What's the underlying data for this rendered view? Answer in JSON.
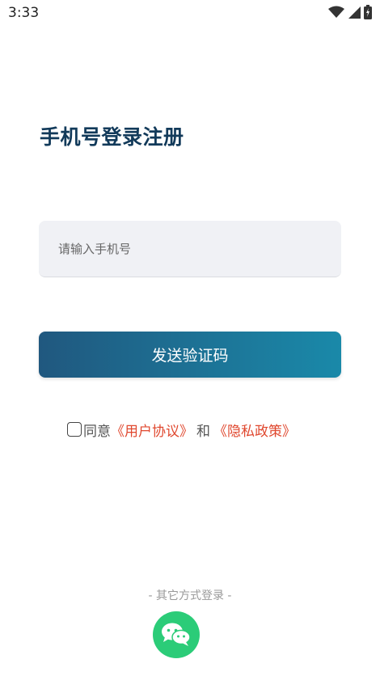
{
  "status_bar": {
    "time": "3:33",
    "icons": [
      "wifi-icon",
      "signal-icon",
      "battery-icon"
    ]
  },
  "page": {
    "title": "手机号登录注册"
  },
  "phone_input": {
    "placeholder": "请输入手机号",
    "value": ""
  },
  "send_button": {
    "label": "发送验证码"
  },
  "agreement": {
    "checked": false,
    "prefix": "同意",
    "user_agreement": "《用户协议》",
    "conjunction": "和",
    "privacy_policy": "《隐私政策》"
  },
  "other_login": {
    "label": "- 其它方式登录 -",
    "wechat_icon": "wechat-icon"
  },
  "colors": {
    "title": "#123a5a",
    "button_gradient_start": "#20587f",
    "button_gradient_end": "#1a89a9",
    "link": "#e0482f",
    "wechat": "#2bcc78",
    "input_bg": "#f0f1f5"
  }
}
